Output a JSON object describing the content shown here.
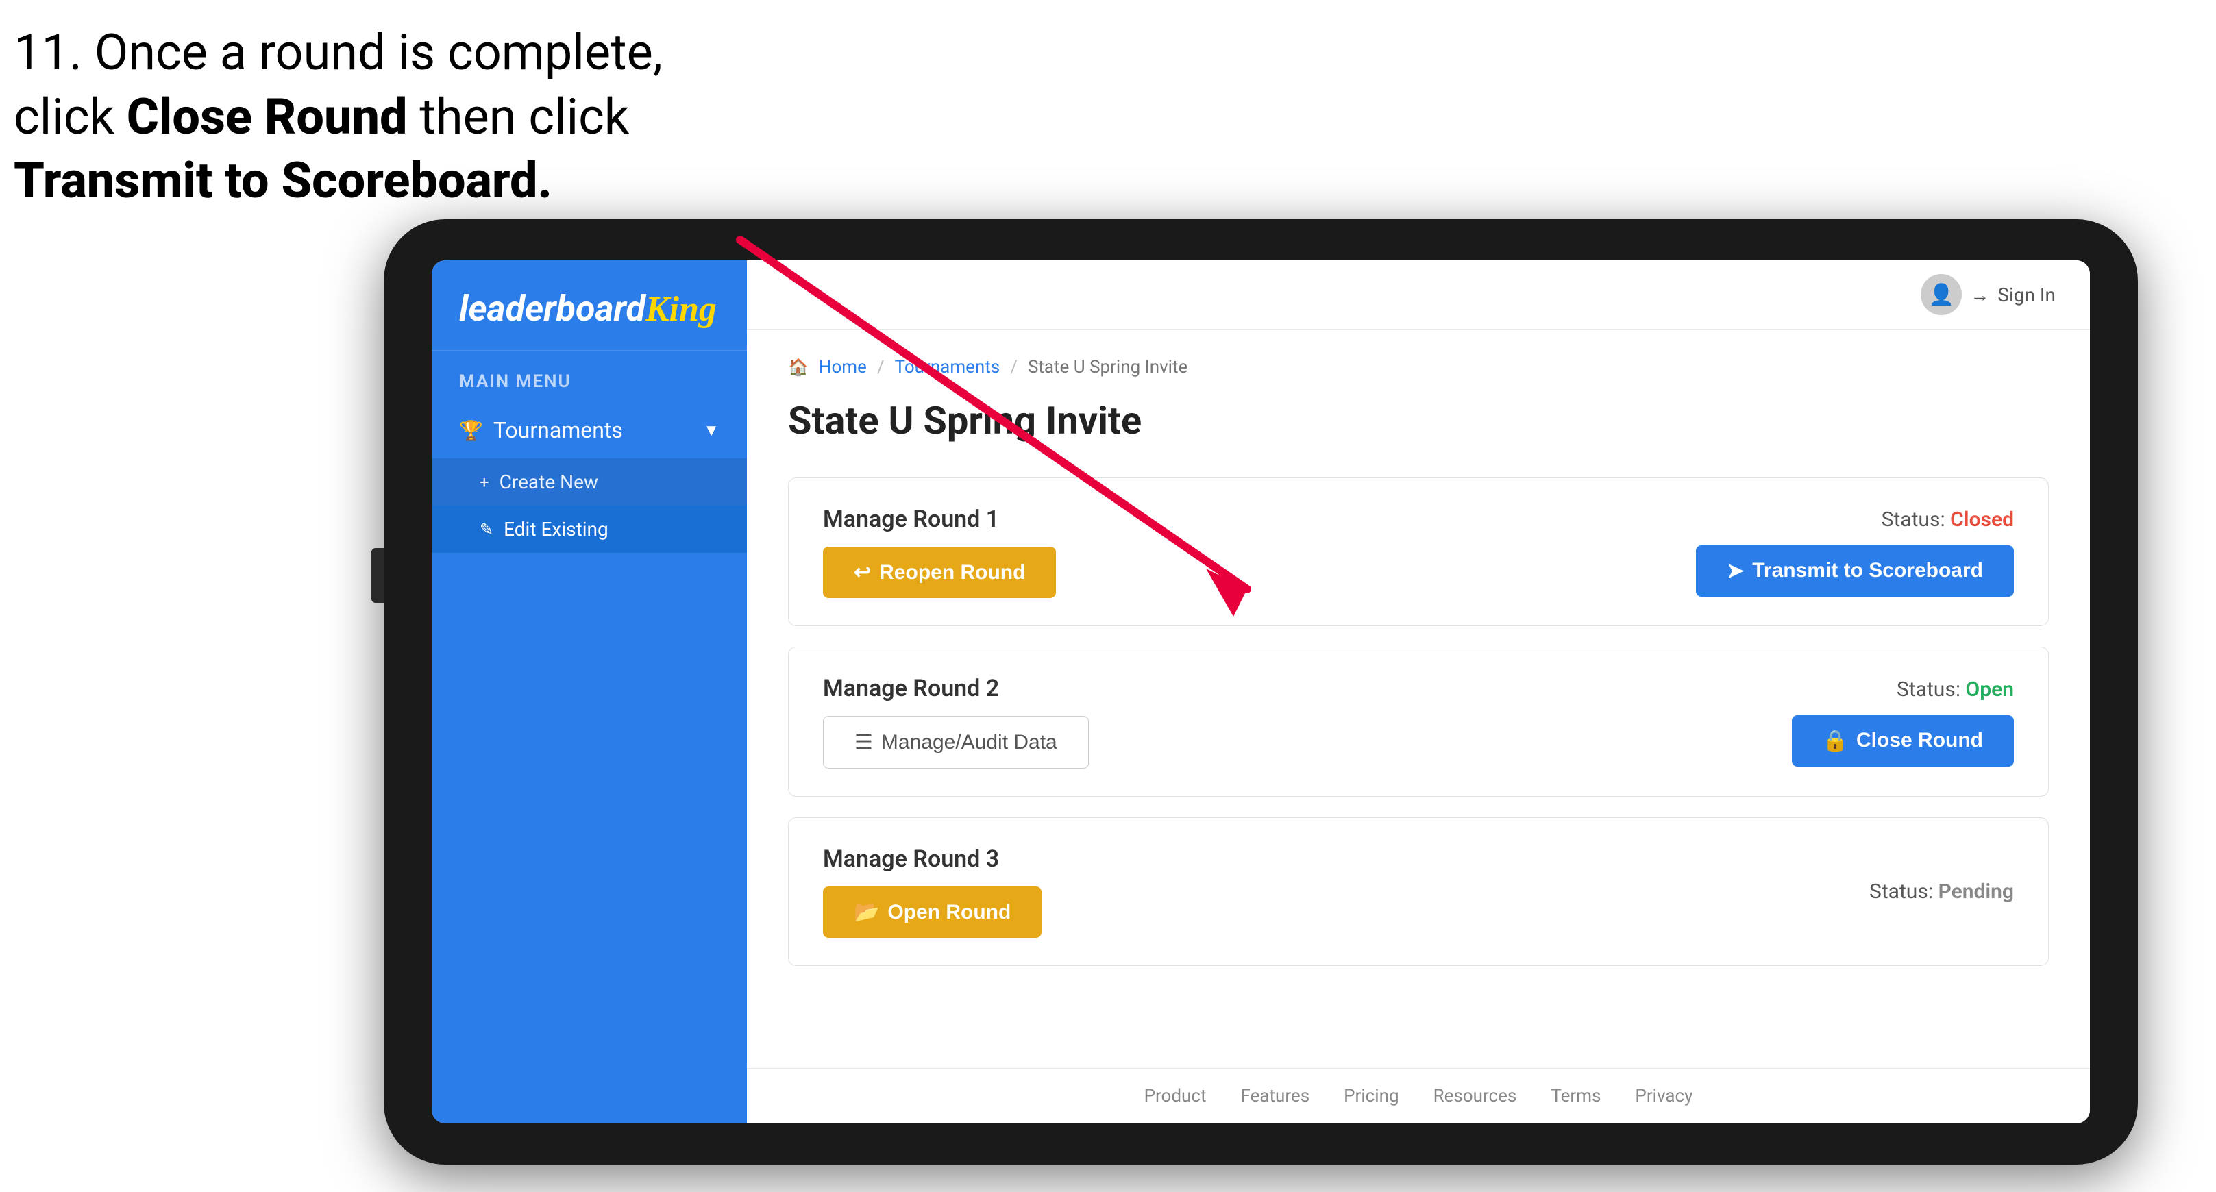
{
  "instruction": {
    "line1": "11. Once a round is complete,",
    "line2_prefix": "click ",
    "line2_bold": "Close Round",
    "line2_suffix": " then click",
    "line3": "Transmit to Scoreboard."
  },
  "app": {
    "logo": {
      "leaderboard": "leaderboard",
      "king": "King"
    },
    "sidebar": {
      "menu_label": "MAIN MENU",
      "items": [
        {
          "label": "Tournaments",
          "icon": "🏆",
          "expanded": true,
          "subitems": [
            {
              "label": "Create New",
              "icon": "+"
            },
            {
              "label": "Edit Existing",
              "icon": "✎",
              "active": true
            }
          ]
        }
      ]
    },
    "topbar": {
      "sign_in": "Sign In"
    },
    "breadcrumb": {
      "home": "Home",
      "tournaments": "Tournaments",
      "current": "State U Spring Invite"
    },
    "page_title": "State U Spring Invite",
    "rounds": [
      {
        "manage_label": "Manage Round 1",
        "status_label": "Status:",
        "status_value": "Closed",
        "status_type": "closed",
        "primary_button": "Reopen Round",
        "primary_icon": "↩",
        "secondary_button": "Transmit to Scoreboard",
        "secondary_icon": "➤"
      },
      {
        "manage_label": "Manage Round 2",
        "status_label": "Status:",
        "status_value": "Open",
        "status_type": "open",
        "audit_button": "Manage/Audit Data",
        "audit_icon": "☰",
        "secondary_button": "Close Round",
        "secondary_icon": "🔒"
      },
      {
        "manage_label": "Manage Round 3",
        "status_label": "Status:",
        "status_value": "Pending",
        "status_type": "pending",
        "primary_button": "Open Round",
        "primary_icon": "📂"
      }
    ],
    "footer": {
      "links": [
        "Product",
        "Features",
        "Pricing",
        "Resources",
        "Terms",
        "Privacy"
      ]
    }
  }
}
